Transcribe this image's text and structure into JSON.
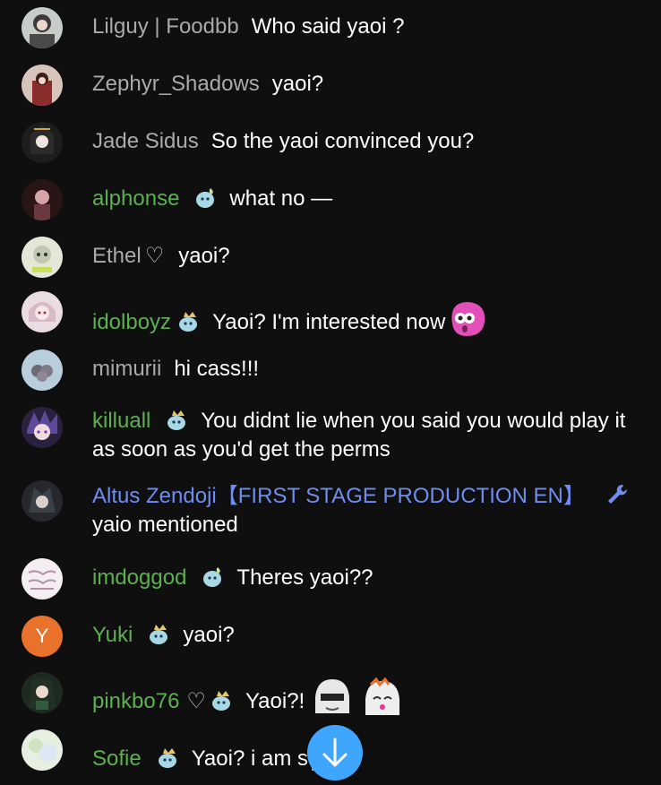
{
  "messages": [
    {
      "author": "Lilguy | Foodbb",
      "text": "Who said yaoi ?",
      "author_style": "plain",
      "avatar": "anime-avatar"
    },
    {
      "author": "Zephyr_Shadows",
      "text": "yaoi?",
      "author_style": "plain",
      "avatar": "anime-avatar"
    },
    {
      "author": "Jade Sidus",
      "text": "So the yaoi convinced you?",
      "author_style": "plain",
      "avatar": "anime-avatar"
    },
    {
      "author": "alphonse",
      "text": "what no —",
      "author_style": "member",
      "badge": "member-badge-icon",
      "avatar": "anime-avatar"
    },
    {
      "author": "Ethel",
      "heart": "♡",
      "text": "yaoi?",
      "author_style": "plain",
      "avatar": "anime-avatar"
    },
    {
      "author": "idolboyz",
      "text": "Yaoi? I'm interested now",
      "author_style": "member",
      "badge": "member-badge-icon",
      "emote": "pink-blob-emote",
      "avatar": "anime-avatar"
    },
    {
      "author": "mimurii",
      "text": "hi cass!!!",
      "author_style": "plain",
      "avatar": "anime-avatar"
    },
    {
      "author": "killuall",
      "text": "You didnt lie when you said you would play it as soon as you'd get the perms",
      "author_style": "member",
      "badge": "member-badge-icon",
      "avatar": "anime-avatar"
    },
    {
      "author": "Altus Zendoji【FIRST STAGE PRODUCTION EN】",
      "text": "yaio mentioned",
      "author_style": "mod",
      "badge": "wrench-icon",
      "avatar": "anime-avatar"
    },
    {
      "author": "imdoggod",
      "text": "Theres yaoi??",
      "author_style": "member",
      "badge": "member-badge-icon",
      "avatar": "anime-avatar"
    },
    {
      "author": "Yuki",
      "text": "yaoi?",
      "author_style": "member",
      "badge": "member-badge-icon",
      "avatar_letter": "Y",
      "avatar_color": "#e8712c"
    },
    {
      "author": "pinkbo76",
      "heart": "♡",
      "text": "Yaoi?!",
      "author_style": "member",
      "badge": "member-badge-icon",
      "emote": "anime-face-emote",
      "avatar": "anime-avatar"
    },
    {
      "author": "Sofie",
      "text": "Yaoi? i am s",
      "author_style": "member",
      "badge": "member-badge-icon",
      "emote": "anime-face-emote",
      "avatar": "anime-avatar"
    }
  ],
  "scroll_button": {
    "icon": "arrow-down-icon",
    "color": "#3ea6ff"
  }
}
